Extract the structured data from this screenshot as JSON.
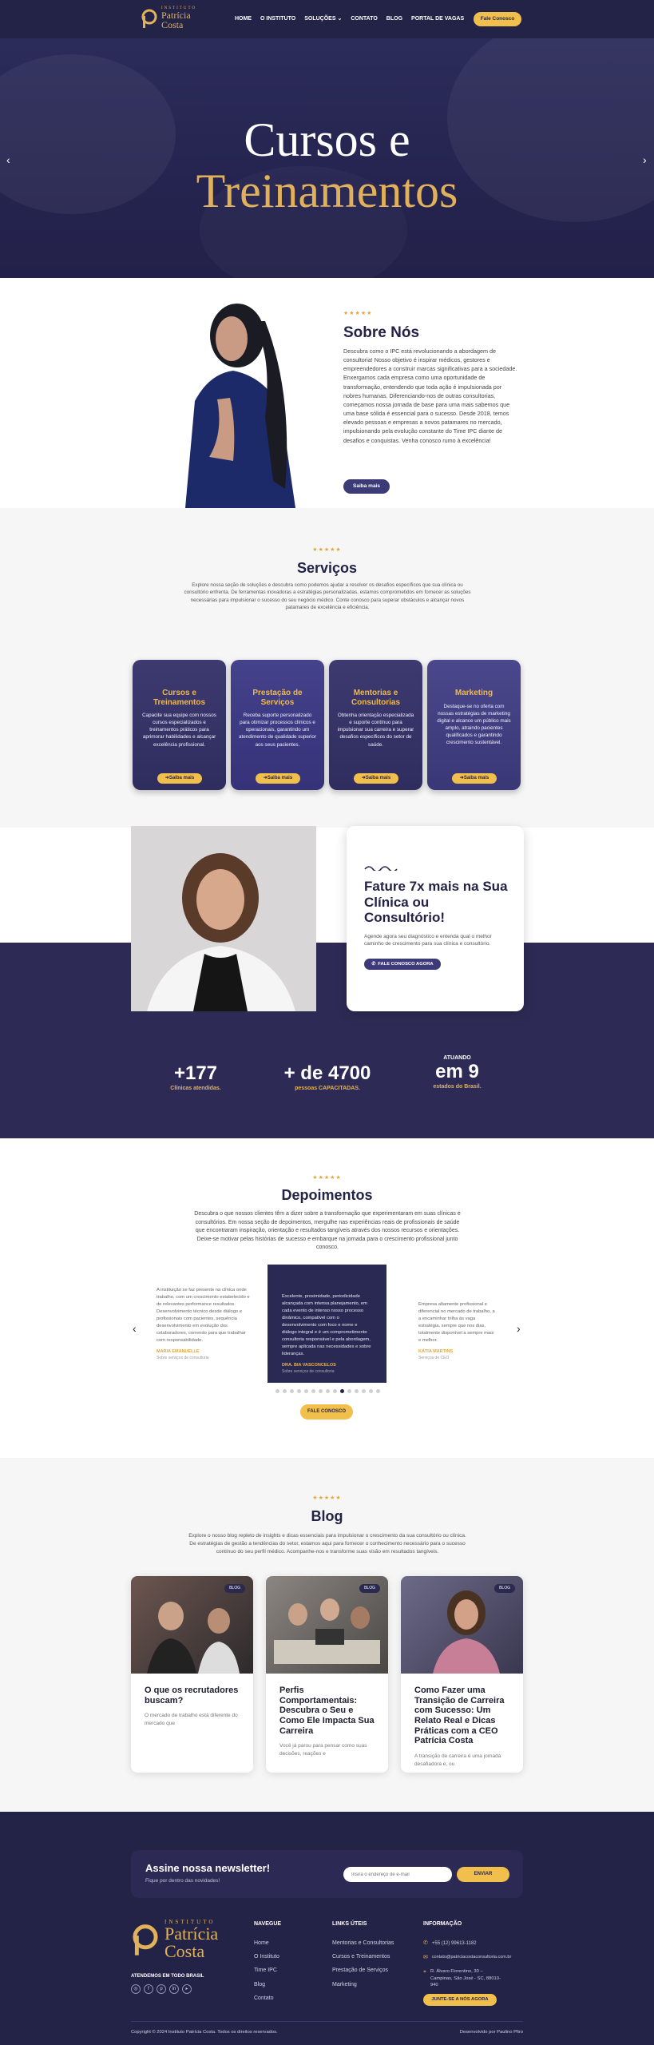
{
  "header": {
    "logo_top": "INSTITUTO",
    "logo_name1": "Patrícia",
    "logo_name2": "Costa",
    "nav": [
      "HOME",
      "O INSTITUTO",
      "SOLUÇÕES",
      "CONTATO",
      "BLOG",
      "PORTAL DE VAGAS"
    ],
    "cta": "Fale Conosco"
  },
  "hero": {
    "title1": "Cursos e",
    "title2": "Treinamentos"
  },
  "about": {
    "stars": "★★★★★",
    "title": "Sobre Nós",
    "text": "Descubra como o IPC está revolucionando a abordagem de consultoria! Nosso objetivo é inspirar médicos, gestores e empreendedores a construir marcas significativas para a sociedade. Enxergamos cada empresa como uma oportunidade de transformação, entendendo que toda ação é impulsionada por nobres humanas. Diferenciando-nos de outras consultorias, começamos nossa jornada de base para uma mais sabemos que uma base sólida é essencial para o sucesso. Desde 2018, temos elevado pessoas e empresas a novos patamares no mercado, impulsionando pela evolução constante do Time IPC diante de desafios e conquistas. Venha conosco rumo à excelência!",
    "button": "Saiba mais"
  },
  "services": {
    "stars": "★★★★★",
    "title": "Serviços",
    "text": "Explore nossa seção de soluções e descubra como podemos ajudar a resolver os desafios específicos que sua clínica ou consultório enfrenta. De ferramentas inovadoras a estratégias personalizadas, estamos comprometidos em fornecer as soluções necessárias para impulsionar o sucesso do seu negócio médico. Conte conosco para superar obstáculos e alcançar novos patamares de excelência e eficiência.",
    "cards": [
      {
        "title": "Cursos e Treinamentos",
        "text": "Capacite sua equipe com nossos cursos especializados e treinamentos práticos para aprimorar habilidades e alcançar excelência profissional.",
        "button": "Saiba mais"
      },
      {
        "title": "Prestação de Serviços",
        "text": "Receba suporte personalizado para otimizar processos clínicos e operacionais, garantindo um atendimento de qualidade superior aos seus pacientes.",
        "button": "Saiba mais"
      },
      {
        "title": "Mentorias e Consultorias",
        "text": "Obtenha orientação especializada e suporte contínuo para impulsionar sua carreira e superar desafios específicos do setor de saúde.",
        "button": "Saiba mais"
      },
      {
        "title": "Marketing",
        "text": "Destaque-se no oferta com nossas estratégias de marketing digital e alcance um público mais amplo, atraindo pacientes qualificados e garantindo crescimento sustentável.",
        "button": "Saiba mais"
      }
    ]
  },
  "cta": {
    "title": "Fature 7x mais na Sua Clínica ou Consultório!",
    "text": "Agende agora seu diagnóstico e entenda qual o melhor caminho de crescimento para sua clínica e consultório.",
    "button": "FALE CONOSCO AGORA"
  },
  "stats": [
    {
      "pre": "",
      "value": "+177",
      "label": "Clínicas atendidas."
    },
    {
      "pre": "",
      "value": "+ de  4700",
      "label": "pessoas CAPACITADAS."
    },
    {
      "pre": "ATUANDO",
      "value": "em 9",
      "label": "estados do Brasil."
    }
  ],
  "testimonials": {
    "stars": "★★★★★",
    "title": "Depoimentos",
    "text": "Descubra o que nossos clientes têm a dizer sobre a transformação que experimentaram em suas clínicas e consultórios. Em nossa seção de depoimentos, mergulhe nas experiências reais de profissionais de saúde que encontraram inspiração, orientação e resultados tangíveis através dos nossos recursos e orientações. Deixe-se motivar pelas histórias de sucesso e embarque na jornada para o crescimento profissional junto conosco.",
    "items": [
      {
        "text": "A instituição se faz presente na clínica onde trabalho, com um crescimento estabelecido e de relevantes performance resultados. Desenvolvimento técnico desde diálogo e profissionais com pacientes, sequência desenvolvimento em evolução dos colaboradores, correndo para que trabalhar com responsabilidade.",
        "name": "MARIA EMANUELLE",
        "role": "Sobre serviços de consultoria"
      },
      {
        "text": "Excelente, proximidade, periodicidade alcançada com intensa planejamento, em cada evento de intenso nosso processo dinâmico, compatível com o desenvolvimento com foco e nome e diálogo integral e é um comprometimento consultoria responsável e pela abordagem, sempre aplicada nas necessidades e sobre lideranças.",
        "name": "DRA. BIA VASCONCELOS",
        "role": "Sobre serviços de consultoria"
      },
      {
        "text": "Empresa altamente profissional e diferencial no mercado de trabalho, a a encaminhar trilha às vaga estratégia, sempre que nos dias, totalmente disponível a sempre mais e melhor.",
        "name": "KÁTIA MARTINS",
        "role": "Serviços de CEO"
      }
    ],
    "button": "FALE CONOSCO"
  },
  "blog": {
    "stars": "★★★★★",
    "title": "Blog",
    "text": "Explore o nosso blog repleto de insights e dicas essenciais para impulsionar o crescimento da sua consultório ou clínica. De estratégias de gestão a tendências do setor, estamos aqui para fornecer o conhecimento necessário para o sucesso contínuo do seu perfil médico. Acompanhe-nos e transforme suas visão em resultados tangíveis.",
    "posts": [
      {
        "tag": "BLOG",
        "title": "O que os recrutadores buscam?",
        "text": "O mercado de trabalho está diferente do mercado que"
      },
      {
        "tag": "BLOG",
        "title": "Perfis Comportamentais: Descubra o Seu e Como Ele Impacta Sua Carreira",
        "text": "Você já parou para pensar como suas decisões, reações e"
      },
      {
        "tag": "BLOG",
        "title": "Como Fazer uma Transição de Carreira com Sucesso: Um Relato Real e Dicas Práticas com a CEO Patrícia Costa",
        "text": "A transição de carreira é uma jornada desafiadora e, ou"
      }
    ]
  },
  "newsletter": {
    "title": "Assine nossa newsletter!",
    "subtitle": "Fique por dentro das novidades!",
    "placeholder": "Insira o endereço de e-mail",
    "button": "ENVIAR"
  },
  "footer": {
    "logo_top": "INSTITUTO",
    "logo_name1": "Patrícia",
    "logo_name2": "Costa",
    "tagline": "ATENDEMOS EM TODO BRASIL",
    "nav_title": "NAVEGUE",
    "nav": [
      "Home",
      "O Instituto",
      "Time IPC",
      "Blog",
      "Contato"
    ],
    "links_title": "LINKS ÚTEIS",
    "links": [
      "Mentorias e Consultorias",
      "Cursos e Treinamentos",
      "Prestação de Serviços",
      "Marketing"
    ],
    "info_title": "INFORMAÇÃO",
    "phone": "+55 (12) 99613-1182",
    "email": "contato@patriciacostaconsultoria.com.br",
    "address": "R. Álvaro Fiorentino, 30 – Campinas, São José - SC, 88010-940",
    "join": "JUNTE-SE A NÓS AGORA",
    "copyright": "Copyright © 2024 Instituto Patrícia Costa. Todos os direitos reservados.",
    "dev": "Desenvolvido por Paulino Pfiro"
  },
  "colors": {
    "navy": "#232247",
    "gold": "#e2b25a",
    "yellow": "#f1bf4c"
  }
}
